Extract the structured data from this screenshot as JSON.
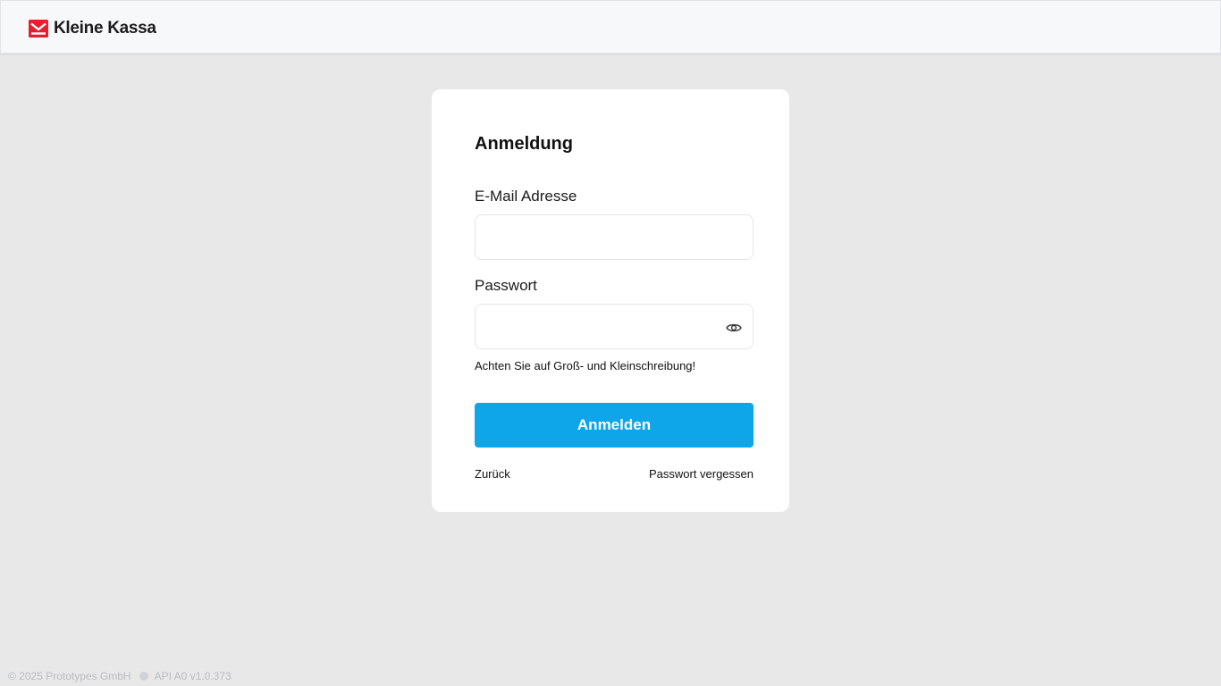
{
  "header": {
    "brand_name": "Kleine Kassa",
    "brand_color": "#e5202e"
  },
  "login": {
    "title": "Anmeldung",
    "email_label": "E-Mail Adresse",
    "email_value": "",
    "password_label": "Passwort",
    "password_value": "",
    "password_toggle_icon": "eye-icon",
    "case_hint": "Achten Sie auf Groß- und Kleinschreibung!",
    "submit_label": "Anmelden",
    "submit_color": "#0ea5e9",
    "back_label": "Zurück",
    "forgot_label": "Passwort vergessen"
  },
  "footer": {
    "copyright": "© 2025 Prototypes GmbH",
    "api_version": "API A0 v1.0.373"
  }
}
